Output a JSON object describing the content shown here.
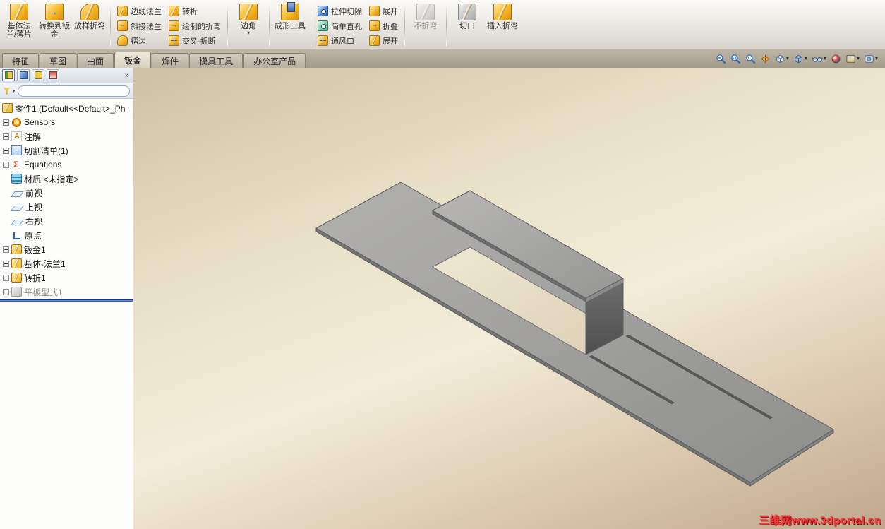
{
  "ribbon": {
    "group1": [
      {
        "label": "基体法兰/薄片",
        "icon": "base-flange-icon"
      },
      {
        "label": "转换到钣金",
        "icon": "convert-to-sheet-metal-icon"
      },
      {
        "label": "放样折弯",
        "icon": "lofted-bend-icon"
      }
    ],
    "col1": [
      {
        "label": "边线法兰",
        "icon": "edge-flange-icon"
      },
      {
        "label": "斜接法兰",
        "icon": "miter-flange-icon"
      },
      {
        "label": "褶边",
        "icon": "hem-icon"
      }
    ],
    "col2": [
      {
        "label": "转折",
        "icon": "jog-icon"
      },
      {
        "label": "绘制的折弯",
        "icon": "sketched-bend-icon"
      },
      {
        "label": "交叉-折断",
        "icon": "cross-break-icon"
      }
    ],
    "corner": {
      "label": "边角",
      "icon": "corner-icon"
    },
    "forming": {
      "label": "成形工具",
      "icon": "forming-tool-icon"
    },
    "col3": [
      {
        "label": "拉伸切除",
        "icon": "extruded-cut-icon"
      },
      {
        "label": "简单直孔",
        "icon": "simple-hole-icon"
      },
      {
        "label": "通风口",
        "icon": "vent-icon"
      }
    ],
    "col4": [
      {
        "label": "展开",
        "icon": "unfold-icon"
      },
      {
        "label": "折叠",
        "icon": "fold-icon"
      },
      {
        "label": "展开",
        "icon": "flatten-icon"
      }
    ],
    "group2": [
      {
        "label": "不折弯",
        "icon": "no-bends-icon",
        "disabled": true
      },
      {
        "label": "切口",
        "icon": "rip-icon"
      },
      {
        "label": "插入折弯",
        "icon": "insert-bends-icon"
      }
    ]
  },
  "tabs": {
    "items": [
      "特征",
      "草图",
      "曲面",
      "钣金",
      "焊件",
      "模具工具",
      "办公室产品"
    ],
    "active": "钣金"
  },
  "headsup_icons": [
    "zoom-to-fit",
    "zoom-to-area",
    "zoom-previous",
    "section-view",
    "view-orientation",
    "display-style",
    "hide-show-items",
    "edit-appearance",
    "apply-scene",
    "view-settings"
  ],
  "sidebar": {
    "panel_tabs": [
      "featuremanager",
      "propertymanager",
      "configurationmanager",
      "dimxpertmanager"
    ],
    "overflow": "»",
    "filter_placeholder": "",
    "tree": [
      {
        "label": "零件1 (Default<<Default>_Ph",
        "icon": "part"
      },
      {
        "label": "Sensors",
        "icon": "sensors",
        "plus": true
      },
      {
        "label": "注解",
        "icon": "annotations",
        "plus": true
      },
      {
        "label": "切割清单(1)",
        "icon": "cut-list",
        "plus": true
      },
      {
        "label": "Equations",
        "icon": "equations",
        "plus": true
      },
      {
        "label": "材质 <未指定>",
        "icon": "material"
      },
      {
        "label": "前视",
        "icon": "plane"
      },
      {
        "label": "上视",
        "icon": "plane"
      },
      {
        "label": "右视",
        "icon": "plane"
      },
      {
        "label": "原点",
        "icon": "origin"
      },
      {
        "label": "钣金1",
        "icon": "sheet-metal-feature",
        "plus": true
      },
      {
        "label": "基体-法兰1",
        "icon": "base-flange-feature",
        "plus": true
      },
      {
        "label": "转折1",
        "icon": "jog-feature",
        "plus": true
      },
      {
        "label": "平板型式1",
        "icon": "flat-pattern",
        "plus": true,
        "grayed": true
      }
    ]
  },
  "viewport": {
    "watermark": "三维网www.3dportal.cn"
  },
  "colors": {
    "accent_blue": "#2a62c9",
    "viewport_top": "#cfc0a3",
    "viewport_mid": "#f3edda",
    "viewport_bottom": "#bfa88d",
    "part_gray": "#9c9c9c",
    "watermark_red": "#f23535"
  }
}
